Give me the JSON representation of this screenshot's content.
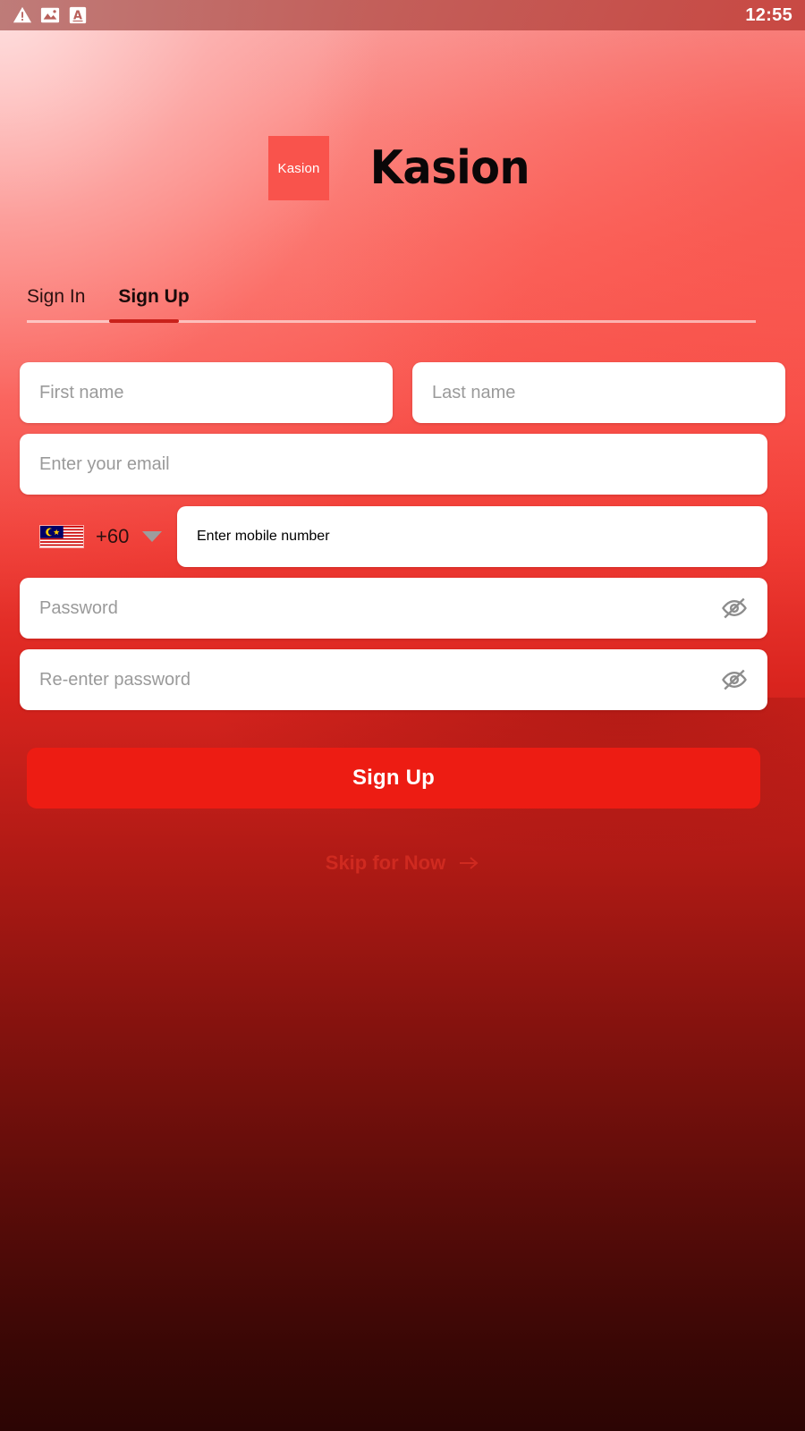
{
  "status_bar": {
    "time": "12:55",
    "icons": [
      {
        "name": "warning-triangle-icon",
        "glyph": "warning"
      },
      {
        "name": "image-icon",
        "glyph": "image"
      },
      {
        "name": "font-a-icon",
        "glyph": "letter-a"
      }
    ]
  },
  "brand": {
    "mark_text": "Kasion",
    "wordmark": "Kasion",
    "mark_color": "#f9534c"
  },
  "tabs": [
    {
      "label": "Sign In",
      "active": false
    },
    {
      "label": "Sign Up",
      "active": true
    }
  ],
  "form": {
    "first_name": {
      "placeholder": "First name",
      "value": ""
    },
    "last_name": {
      "placeholder": "Last name",
      "value": ""
    },
    "email": {
      "placeholder": "Enter your email",
      "value": ""
    },
    "country_code": {
      "value": "+60",
      "flag": "malaysia-flag-icon"
    },
    "mobile": {
      "placeholder": "Enter mobile number",
      "value": ""
    },
    "password": {
      "placeholder": "Password",
      "value": "",
      "toggle_icon": "eye-off-icon"
    },
    "confirm_password": {
      "placeholder": "Re-enter password",
      "value": "",
      "toggle_icon": "eye-off-icon"
    }
  },
  "actions": {
    "submit_label": "Sign Up",
    "submit_color": "#ed1c13",
    "skip_label": "Skip for Now",
    "skip_color": "#cf2a20"
  },
  "theme": {
    "bg_top": "#f9a7a6",
    "bg_mid": "#f8514b",
    "bg_bottom": "#2c0504",
    "accent": "#c9211b",
    "field_bg": "#ffffff",
    "placeholder": "#9a9a9a"
  }
}
